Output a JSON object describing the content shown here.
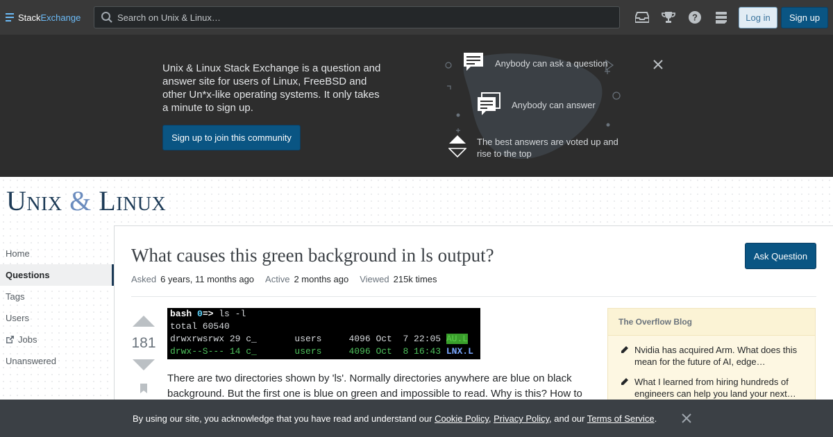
{
  "topbar": {
    "logo_part1": "Stack",
    "logo_part2": "Exchange",
    "search_placeholder": "Search on Unix & Linux…",
    "icons": [
      "inbox-icon",
      "achievements-icon",
      "help-icon",
      "site-switcher-icon"
    ],
    "login_label": "Log in",
    "signup_label": "Sign up"
  },
  "hero": {
    "pitch": "Unix & Linux Stack Exchange is a question and answer site for users of Linux, FreeBSD and other Un*x-like operating systems. It only takes a minute to sign up.",
    "join_label": "Sign up to join this community",
    "features": {
      "ask": "Anybody can ask a question",
      "answer": "Anybody can answer",
      "vote_line1": "The best answers are voted up and",
      "vote_line2": "rise to the top"
    }
  },
  "site": {
    "title_part1": "Unix ",
    "title_amp": "&",
    "title_part2": " Linux"
  },
  "leftnav": {
    "items": [
      {
        "label": "Home"
      },
      {
        "label": "Questions"
      },
      {
        "label": "Tags"
      },
      {
        "label": "Users"
      },
      {
        "label": "Jobs"
      },
      {
        "label": "Unanswered"
      }
    ]
  },
  "question": {
    "title": "What causes this green background in ls output?",
    "ask_label": "Ask Question",
    "asked_label": "Asked",
    "asked_value": "6 years, 11 months ago",
    "active_label": "Active",
    "active_value": "2 months ago",
    "viewed_label": "Viewed",
    "viewed_value": "215k times",
    "votes": "181",
    "terminal": {
      "prompt_bash": "bash",
      "prompt_zero": "0",
      "prompt_arrow": "=>",
      "command": " ls -l",
      "total": "total 60540",
      "row1_text": "drwxrwsrwx 29 c_       users     4096 Oct  7 22:05 ",
      "row1_name": "AU.L",
      "row2_text": "drwx--S--- 14 c_       users     4096 Oct  8 16:43 ",
      "row2_name": "LNX.L"
    },
    "body": "There are two directories shown by 'ls'. Normally directories anywhere are blue on black background. But the first one is blue on green and impossible to read. Why is this? How to"
  },
  "blog": {
    "heading": "The Overflow Blog",
    "entries": [
      {
        "line1": "Nvidia has acquired Arm. What does this",
        "line2": "mean for the future of AI, edge…"
      },
      {
        "line1": "What I learned from hiring hundreds of",
        "line2": "engineers can help you land your next…"
      }
    ]
  },
  "cookie": {
    "prefix": "By using our site, you acknowledge that you have read and understand our ",
    "cookie_policy": "Cookie Policy",
    "sep1": ", ",
    "privacy_policy": "Privacy Policy",
    "sep2": ", and our ",
    "terms": "Terms of Service",
    "suffix": "."
  },
  "colors": {
    "topbar": "#393939",
    "hero": "#2d2d2d",
    "brand_blue": "#0a5583",
    "title_navy": "#1c3a56"
  }
}
